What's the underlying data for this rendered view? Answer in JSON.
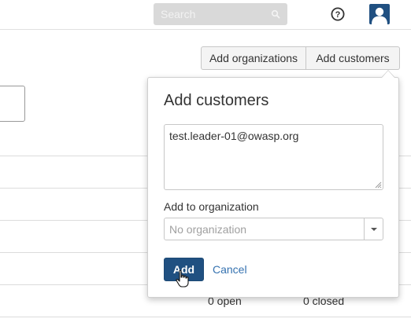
{
  "header": {
    "search": {
      "placeholder": "Search",
      "value": ""
    },
    "icons": {
      "search": "search-icon",
      "help": "help-icon",
      "avatar": "user-avatar-icon"
    }
  },
  "actions": {
    "add_organizations_label": "Add organizations",
    "add_customers_label": "Add customers"
  },
  "dialog": {
    "title": "Add customers",
    "emails_value": "test.leader-01@owasp.org",
    "organization_label": "Add to organization",
    "organization_placeholder": "No organization",
    "add_label": "Add",
    "cancel_label": "Cancel"
  },
  "background": {
    "open_count": "0 open",
    "closed_count": "0 closed"
  },
  "colors": {
    "primary": "#205081",
    "link": "#3572b0",
    "search_bg": "#d9d9d9"
  }
}
